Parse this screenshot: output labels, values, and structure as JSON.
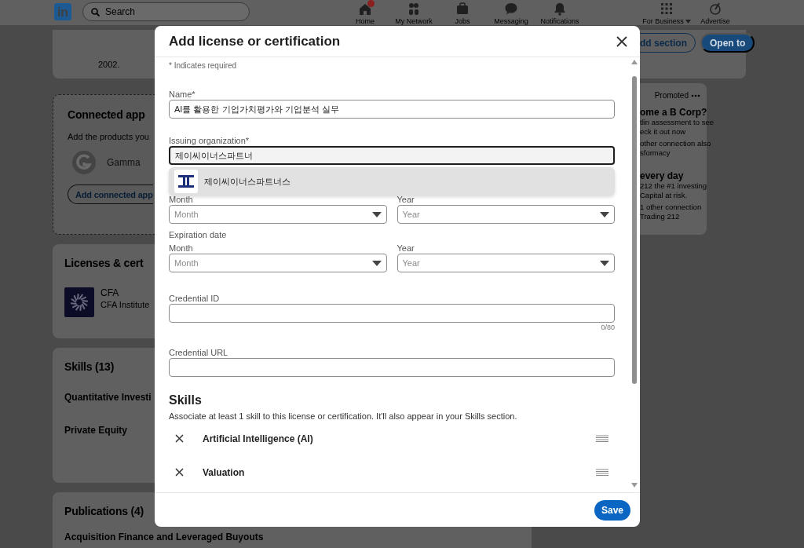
{
  "nav": {
    "logo": "in",
    "search": {
      "placeholder": "Search"
    },
    "items": [
      {
        "label": "Home",
        "badge": true,
        "dropdown": false
      },
      {
        "label": "My Network",
        "badge": false,
        "dropdown": false
      },
      {
        "label": "Jobs",
        "badge": false,
        "dropdown": false
      },
      {
        "label": "Messaging",
        "badge": false,
        "dropdown": false
      },
      {
        "label": "Notifications",
        "badge": false,
        "dropdown": false
      },
      {
        "label": "For Business",
        "badge": false,
        "dropdown": true
      },
      {
        "label": "Advertise",
        "badge": false,
        "dropdown": false
      }
    ]
  },
  "profile": {
    "year": "2002.",
    "buttons": [
      {
        "label": "dd section",
        "kind": "outline"
      },
      {
        "label": "Open to",
        "kind": "primary"
      }
    ]
  },
  "connected_apps": {
    "title": "Connected app",
    "subtitle": "Add the products you",
    "apps": [
      {
        "name": "Gamma"
      }
    ],
    "button": "Add connected app"
  },
  "licenses": {
    "title": "Licenses & cert",
    "items": [
      {
        "name": "CFA",
        "issuer": "CFA Institute"
      }
    ]
  },
  "skills": {
    "title": "Skills (13)",
    "items": [
      "Quantitative Investi",
      "Private Equity"
    ]
  },
  "publications": {
    "title": "Publications (4)",
    "items": [
      "Acquisition Finance and Leveraged Buyouts"
    ]
  },
  "promoted": {
    "label": "Promoted",
    "ads": [
      {
        "title": "ome a B Corp?",
        "lines": [
          "tlin assessment to see",
          "eck it out now"
        ],
        "social": [
          "other connection also",
          "sformacy"
        ]
      },
      {
        "title": "every day",
        "lines": [
          "212 the #1 investing",
          "Capital at risk."
        ],
        "social": [
          "1 other connection",
          "Trading 212"
        ]
      }
    ]
  },
  "modal": {
    "title": "Add license or certification",
    "required_note": "* Indicates required",
    "name": {
      "label": "Name*",
      "value": "AI를 활용한 기업가치평가와 기업분석 실무"
    },
    "organization": {
      "label": "Issuing organization*",
      "value": "제이씨이너스파트너",
      "focused": true,
      "suggestions": [
        {
          "name": "제이씨이너스파트너스",
          "selected": true
        }
      ]
    },
    "issue_date": {
      "month": {
        "label": "Month",
        "placeholder": "Month"
      },
      "year": {
        "label": "Year",
        "placeholder": "Year"
      }
    },
    "expiration_date": {
      "label": "Expiration date",
      "month": {
        "label": "Month",
        "placeholder": "Month"
      },
      "year": {
        "label": "Year",
        "placeholder": "Year"
      }
    },
    "credential_id": {
      "label": "Credential ID",
      "counter": "0/80"
    },
    "credential_url": {
      "label": "Credential URL"
    },
    "skills": {
      "title": "Skills",
      "description": "Associate at least 1 skill to this license or certification. It'll also appear in your Skills section.",
      "items": [
        {
          "name": "Artificial Intelligence (AI)"
        },
        {
          "name": "Valuation"
        }
      ]
    },
    "save": "Save"
  }
}
